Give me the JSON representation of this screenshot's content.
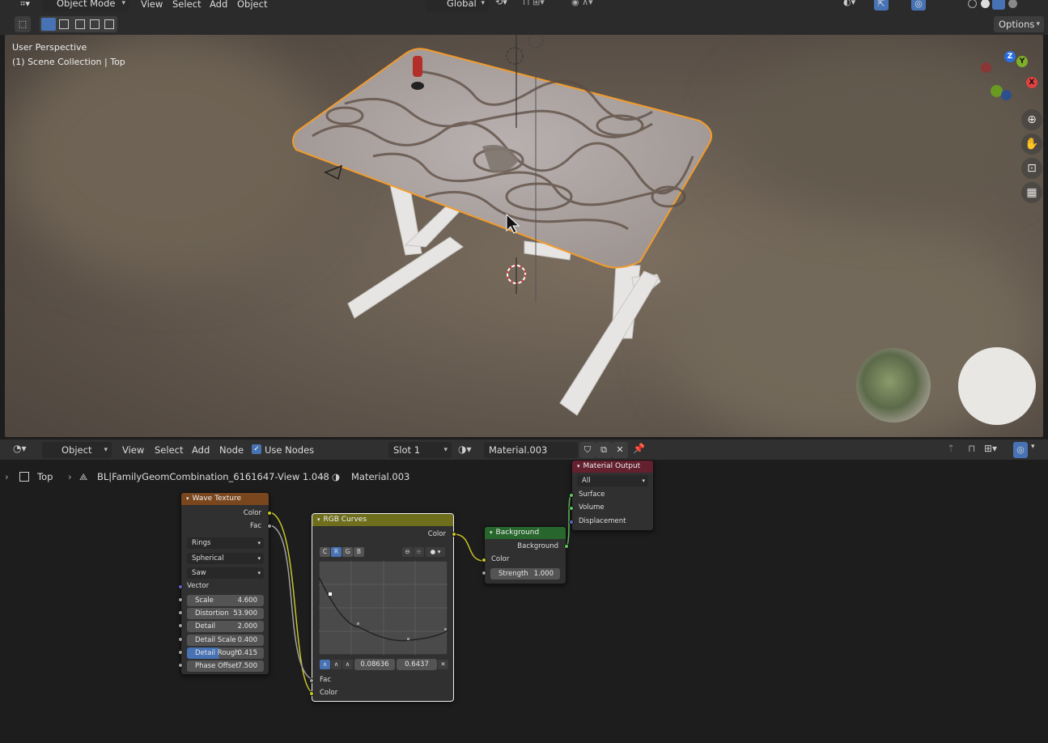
{
  "viewport_header": {
    "mode": "Object Mode",
    "menus": [
      "View",
      "Select",
      "Add",
      "Object"
    ],
    "transform_orientation": "Global",
    "options_label": "Options"
  },
  "viewport": {
    "view_name": "User Perspective",
    "collection_info": "(1) Scene Collection | Top",
    "gizmo_axes": {
      "z": "Z",
      "y": "Y",
      "x": "X"
    }
  },
  "node_header": {
    "editor_mode": "Object",
    "menus": [
      "View",
      "Select",
      "Add",
      "Node"
    ],
    "use_nodes_label": "Use Nodes",
    "use_nodes_checked": true,
    "slot": "Slot 1",
    "material": "Material.003"
  },
  "breadcrumb": {
    "scene": "Top",
    "object": "BL|FamilyGeomCombination_6161647-View 1.048",
    "material": "Material.003"
  },
  "nodes": {
    "wave": {
      "title": "Wave Texture",
      "outputs": [
        "Color",
        "Fac"
      ],
      "wave_type": "Rings",
      "direction": "Spherical",
      "profile": "Saw",
      "vector_label": "Vector",
      "fields": [
        {
          "label": "Scale",
          "value": "4.600"
        },
        {
          "label": "Distortion",
          "value": "53.900"
        },
        {
          "label": "Detail",
          "value": "2.000"
        },
        {
          "label": "Detail Scale",
          "value": "0.400"
        },
        {
          "label": "Detail Rough",
          "value": "0.415"
        },
        {
          "label": "Phase Offset",
          "value": "7.500"
        }
      ]
    },
    "curves": {
      "title": "RGB Curves",
      "output": "Color",
      "channels": [
        "C",
        "R",
        "G",
        "B"
      ],
      "active_channel": "R",
      "point_x": "0.08636",
      "point_y": "0.6437",
      "inputs": [
        "Fac",
        "Color"
      ]
    },
    "background": {
      "title": "Background",
      "output": "Background",
      "input": "Color",
      "strength_label": "Strength",
      "strength_value": "1.000"
    },
    "output": {
      "title": "Material Output",
      "target": "All",
      "inputs": [
        "Surface",
        "Volume",
        "Displacement"
      ]
    }
  },
  "colors": {
    "accent": "#4772b3",
    "wave_header": "#79461d",
    "curves_header": "#6e6e1d",
    "background_header": "#27662c",
    "output_header": "#63202f",
    "selection_outline": "#f29b2c"
  }
}
